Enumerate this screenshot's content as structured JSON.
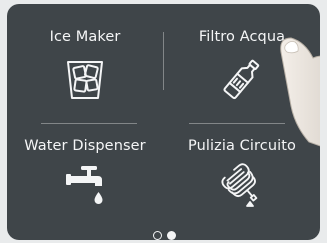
{
  "menu": {
    "tiles": [
      {
        "label": "Ice Maker",
        "icon": "ice-glass-icon"
      },
      {
        "label": "Filtro Acqua",
        "icon": "water-bottle-icon"
      },
      {
        "label": "Water Dispenser",
        "icon": "faucet-icon"
      },
      {
        "label": "Pulizia Circuito",
        "icon": "coiled-hose-icon"
      }
    ]
  },
  "pagination": {
    "current_page": 2,
    "total_pages": 2
  },
  "colors": {
    "panel_background": "#3f4549",
    "foreground": "#f4f5f6",
    "page_background": "#e9ebec"
  }
}
